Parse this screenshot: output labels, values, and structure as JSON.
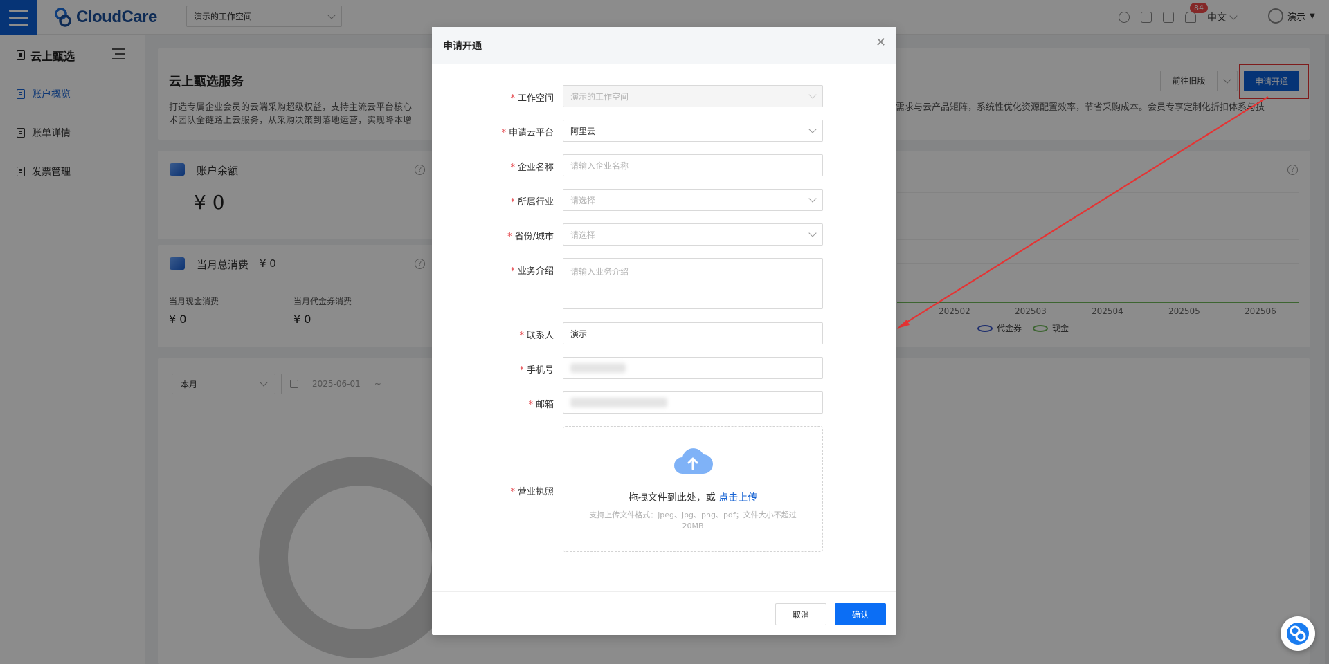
{
  "app": {
    "logo_text": "CloudCare",
    "workspace_selected": "演示的工作空间",
    "notification_count": "84",
    "language": "中文",
    "user_name": "演示"
  },
  "sidebar": {
    "title": "云上甄选",
    "items": [
      {
        "label": "账户概览",
        "active": true
      },
      {
        "label": "账单详情",
        "active": false
      },
      {
        "label": "发票管理",
        "active": false
      }
    ]
  },
  "main": {
    "service_title": "云上甄选服务",
    "service_desc_left": "打造专属企业会员的云端采购超级权益，支持主流云平台核心",
    "service_desc_left_2": "术团队全链路上云服务，从采购决策到落地运营，实现降本增",
    "service_desc_right": "需求与云产品矩阵，系统性优化资源配置效率，节省采购成本。会员专享定制化折扣体系与技",
    "old_version_label": "前往旧版",
    "apply_label": "申请开通",
    "balance_title": "账户余额",
    "balance_value": "¥ 0",
    "monthly_title": "当月总消费",
    "monthly_value": "¥ 0",
    "cash_label": "当月现金消费",
    "cash_value": "¥ 0",
    "voucher_label": "当月代金券消费",
    "voucher_value": "¥ 0",
    "period_select": "本月",
    "date_start": "2025-06-01",
    "date_sep": "~",
    "chart_months": [
      "202502",
      "202503",
      "202504",
      "202505",
      "202506"
    ],
    "legend": [
      "代金券",
      "现金"
    ]
  },
  "modal": {
    "title": "申请开通",
    "fields": {
      "workspace": {
        "label": "工作空间",
        "value": "演示的工作空间"
      },
      "platform": {
        "label": "申请云平台",
        "value": "阿里云"
      },
      "company": {
        "label": "企业名称",
        "placeholder": "请输入企业名称"
      },
      "industry": {
        "label": "所属行业",
        "placeholder": "请选择"
      },
      "region": {
        "label": "省份/城市",
        "placeholder": "请选择"
      },
      "intro": {
        "label": "业务介绍",
        "placeholder": "请输入业务介绍"
      },
      "contact": {
        "label": "联系人",
        "value": "演示"
      },
      "phone": {
        "label": "手机号"
      },
      "email": {
        "label": "邮箱"
      },
      "license": {
        "label": "营业执照"
      }
    },
    "upload": {
      "main_text": "拖拽文件到此处，或 ",
      "link_text": "点击上传",
      "hint": "支持上传文件格式：jpeg、jpg、png、pdf；文件大小不超过20MB"
    },
    "cancel_label": "取消",
    "confirm_label": "确认",
    "required_mark": "*"
  },
  "colors": {
    "brand_blue": "#0b5fd8",
    "confirm_blue": "#0b6ef5",
    "annotation_red": "#e53333",
    "cash_series": "#6fb85a",
    "voucher_series": "#3a57c8"
  }
}
